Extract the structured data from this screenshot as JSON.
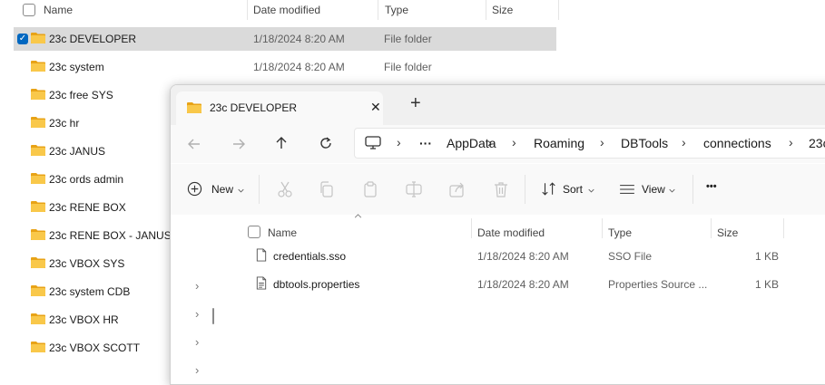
{
  "background_explorer": {
    "columns": {
      "name": "Name",
      "date": "Date modified",
      "type": "Type",
      "size": "Size"
    },
    "rows": [
      {
        "name": "23c DEVELOPER",
        "date": "1/18/2024 8:20 AM",
        "type": "File folder",
        "selected": true
      },
      {
        "name": "23c system",
        "date": "1/18/2024 8:20 AM",
        "type": "File folder"
      },
      {
        "name": "23c free SYS"
      },
      {
        "name": "23c hr"
      },
      {
        "name": "23c JANUS"
      },
      {
        "name": "23c ords admin"
      },
      {
        "name": "23c RENE BOX"
      },
      {
        "name": "23c RENE BOX - JANUS"
      },
      {
        "name": "23c VBOX SYS"
      },
      {
        "name": "23c system CDB"
      },
      {
        "name": "23c VBOX HR"
      },
      {
        "name": "23c VBOX SCOTT"
      }
    ]
  },
  "window": {
    "tab_title": "23c DEVELOPER",
    "close_glyph": "✕",
    "new_tab_glyph": "+",
    "breadcrumb": {
      "ellipsis": "···",
      "items": [
        "AppData",
        "Roaming",
        "DBTools",
        "connections",
        "23c"
      ],
      "separator": "›"
    },
    "toolbar": {
      "new_label": "New",
      "sort_label": "Sort",
      "view_label": "View",
      "more_glyph": "•••"
    },
    "columns": {
      "name": "Name",
      "date": "Date modified",
      "type": "Type",
      "size": "Size"
    },
    "files": [
      {
        "name": "credentials.sso",
        "date": "1/18/2024 8:20 AM",
        "type": "SSO File",
        "size": "1 KB"
      },
      {
        "name": "dbtools.properties",
        "date": "1/18/2024 8:20 AM",
        "type": "Properties Source ...",
        "size": "1 KB"
      }
    ]
  },
  "colors": {
    "selection": "#dadada",
    "folder": "#f4c430",
    "accent": "#0067c0"
  }
}
